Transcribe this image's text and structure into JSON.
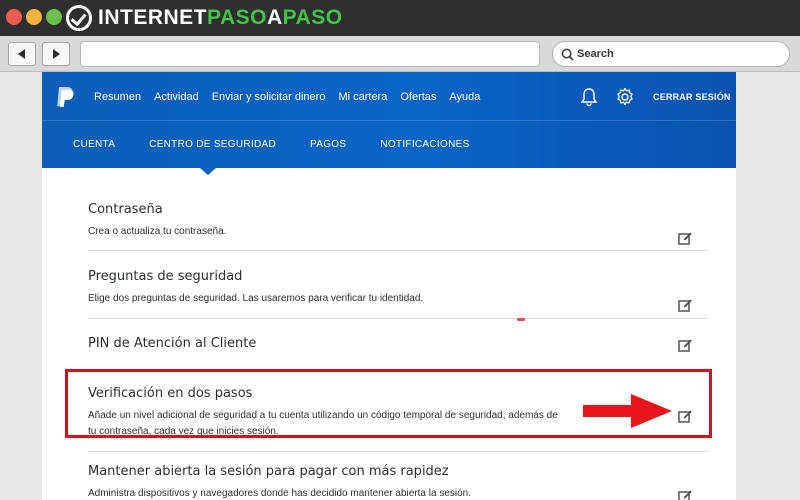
{
  "browser": {
    "brand": {
      "part1": "INTERNET",
      "part2": "PASO",
      "part3": "A",
      "part4": "PASO"
    },
    "search_placeholder": "Search",
    "back_icon": "back-arrow-icon",
    "forward_icon": "forward-arrow-icon"
  },
  "paypal": {
    "top_nav": [
      "Resumen",
      "Actividad",
      "Enviar y solicitar dinero",
      "Mi cartera",
      "Ofertas",
      "Ayuda"
    ],
    "logout": "CERRAR SESIÓN",
    "sub_nav": [
      "CUENTA",
      "CENTRO DE SEGURIDAD",
      "PAGOS",
      "NOTIFICACIONES"
    ],
    "active_sub_nav": "CENTRO DE SEGURIDAD"
  },
  "settings": [
    {
      "title": "Contraseña",
      "desc": "Crea o actualiza tu contraseña."
    },
    {
      "title": "Preguntas de seguridad",
      "desc": "Elige dos preguntas de seguridad. Las usaremos para verificar tu identidad."
    },
    {
      "title": "PIN de Atención al Cliente",
      "desc": ""
    },
    {
      "title": "Verificación en dos pasos",
      "desc": "Añade un nivel adicional de seguridad a tu cuenta utilizando un código temporal de seguridad, además de tu contraseña, cada vez que inicies sesión."
    },
    {
      "title": "Mantener abierta la sesión para pagar con más rapidez",
      "desc": "Administra dispositivos y navegadores donde has decidido mantener abierta la sesión."
    }
  ],
  "colors": {
    "header_blue": "#0a5fbf",
    "highlight_red": "#d0141d",
    "brand_green": "#42c34a"
  }
}
